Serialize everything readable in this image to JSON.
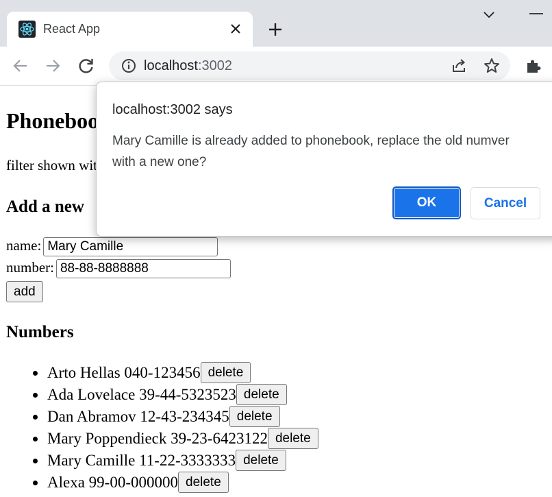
{
  "browser": {
    "tab": {
      "title": "React App"
    },
    "address_bar": {
      "host": "localhost",
      "port": ":3002"
    }
  },
  "page": {
    "heading": "Phonebook",
    "filter_label": "filter shown with",
    "add_heading": "Add a new",
    "form": {
      "name_label": "name:",
      "name_value": "Mary Camille",
      "number_label": "number:",
      "number_value": "88-88-8888888",
      "add_label": "add"
    },
    "numbers_heading": "Numbers",
    "delete_label": "delete",
    "entries": [
      {
        "text": "Arto Hellas 040-123456"
      },
      {
        "text": "Ada Lovelace 39-44-5323523"
      },
      {
        "text": "Dan Abramov 12-43-234345"
      },
      {
        "text": "Mary Poppendieck 39-23-6423122"
      },
      {
        "text": "Mary Camille 11-22-3333333"
      },
      {
        "text": "Alexa 99-00-000000"
      }
    ]
  },
  "dialog": {
    "title": "localhost:3002 says",
    "message": "Mary Camille is already added to phonebook, replace the old numver with a new one?",
    "ok_label": "OK",
    "cancel_label": "Cancel"
  },
  "colors": {
    "accent": "#1a73e8",
    "tab_strip": "#dee1e6",
    "omnibox": "#f1f3f4"
  }
}
